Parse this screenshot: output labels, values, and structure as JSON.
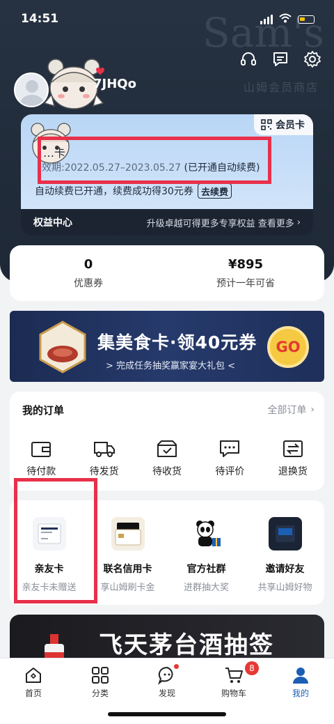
{
  "status": {
    "time": "14:51"
  },
  "header": {
    "watermark": "Sam's",
    "watermark_sub": "山姆会员商店",
    "username": "7JHQo"
  },
  "member_card": {
    "badge": "会员卡",
    "title": "…卡",
    "validity_prefix": "效期:2022.05.27–2023.05.27",
    "validity_note": "(已开通自动续费)",
    "auto_renew_text": "自动续费已开通，续费成功得30元券",
    "auto_renew_button": "去续费",
    "footer_left": "权益中心",
    "footer_right": "升级卓越可得更多专享权益 查看更多"
  },
  "stats": [
    {
      "value": "0",
      "label": "优惠券"
    },
    {
      "value": "¥895",
      "label": "预计一年可省"
    }
  ],
  "banner1": {
    "title": "集美食卡·领40元券",
    "subtitle": "> 完成任务抽奖赢家宴大礼包 <",
    "go": "GO"
  },
  "orders": {
    "title": "我的订单",
    "all": "全部订单",
    "items": [
      {
        "label": "待付款"
      },
      {
        "label": "待发货"
      },
      {
        "label": "待收货"
      },
      {
        "label": "待评价"
      },
      {
        "label": "退换货"
      }
    ]
  },
  "services": [
    {
      "name": "亲友卡",
      "desc": "亲友卡未赠送"
    },
    {
      "name": "联名信用卡",
      "desc": "享山姆刷卡金"
    },
    {
      "name": "官方社群",
      "desc": "进群抽大奖"
    },
    {
      "name": "邀请好友",
      "desc": "共享山姆好物"
    }
  ],
  "banner2": {
    "title": "飞天茅台酒抽签"
  },
  "tabbar": {
    "items": [
      {
        "label": "首页"
      },
      {
        "label": "分类"
      },
      {
        "label": "发现"
      },
      {
        "label": "购物车"
      },
      {
        "label": "我的"
      }
    ],
    "cart_count": "8"
  },
  "colors": {
    "accent": "#1a5fb4",
    "highlight": "#e8304a",
    "hero_bg": "#263242"
  }
}
